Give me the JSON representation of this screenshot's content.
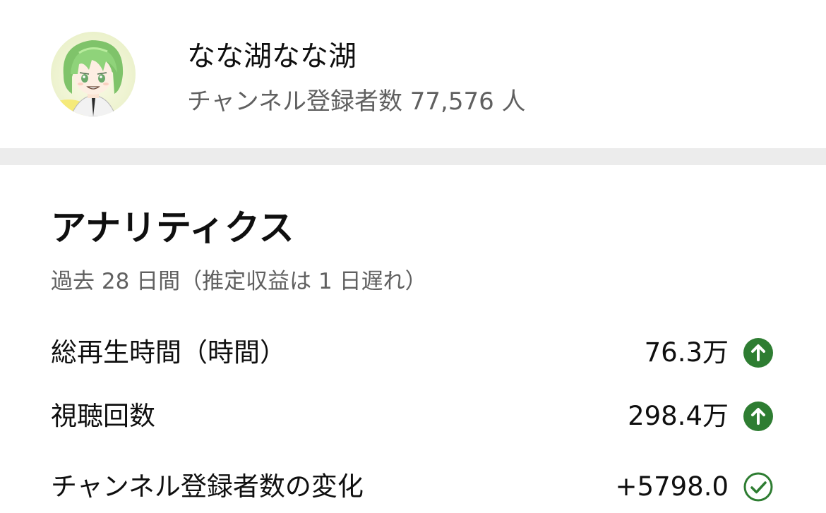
{
  "channel": {
    "name": "なな湖なな湖",
    "subscribers_text": "チャンネル登録者数 77,576 人",
    "avatar_icon": "channel-avatar-anime-green-hair"
  },
  "analytics": {
    "title": "アナリティクス",
    "subtitle": "過去 28 日間（推定収益は 1 日遅れ）",
    "metrics": [
      {
        "label": "総再生時間（時間）",
        "value": "76.3万",
        "icon": "arrow-up-circle-icon",
        "icon_color": "#2e7d32"
      },
      {
        "label": "視聴回数",
        "value": "298.4万",
        "icon": "arrow-up-circle-icon",
        "icon_color": "#2e7d32"
      },
      {
        "label": "チャンネル登録者数の変化",
        "value": "+5798.0",
        "icon": "check-circle-icon",
        "icon_color": "#2e7d32"
      }
    ]
  },
  "colors": {
    "divider": "#ececec",
    "secondary_text": "#606060",
    "positive": "#2e7d32"
  }
}
